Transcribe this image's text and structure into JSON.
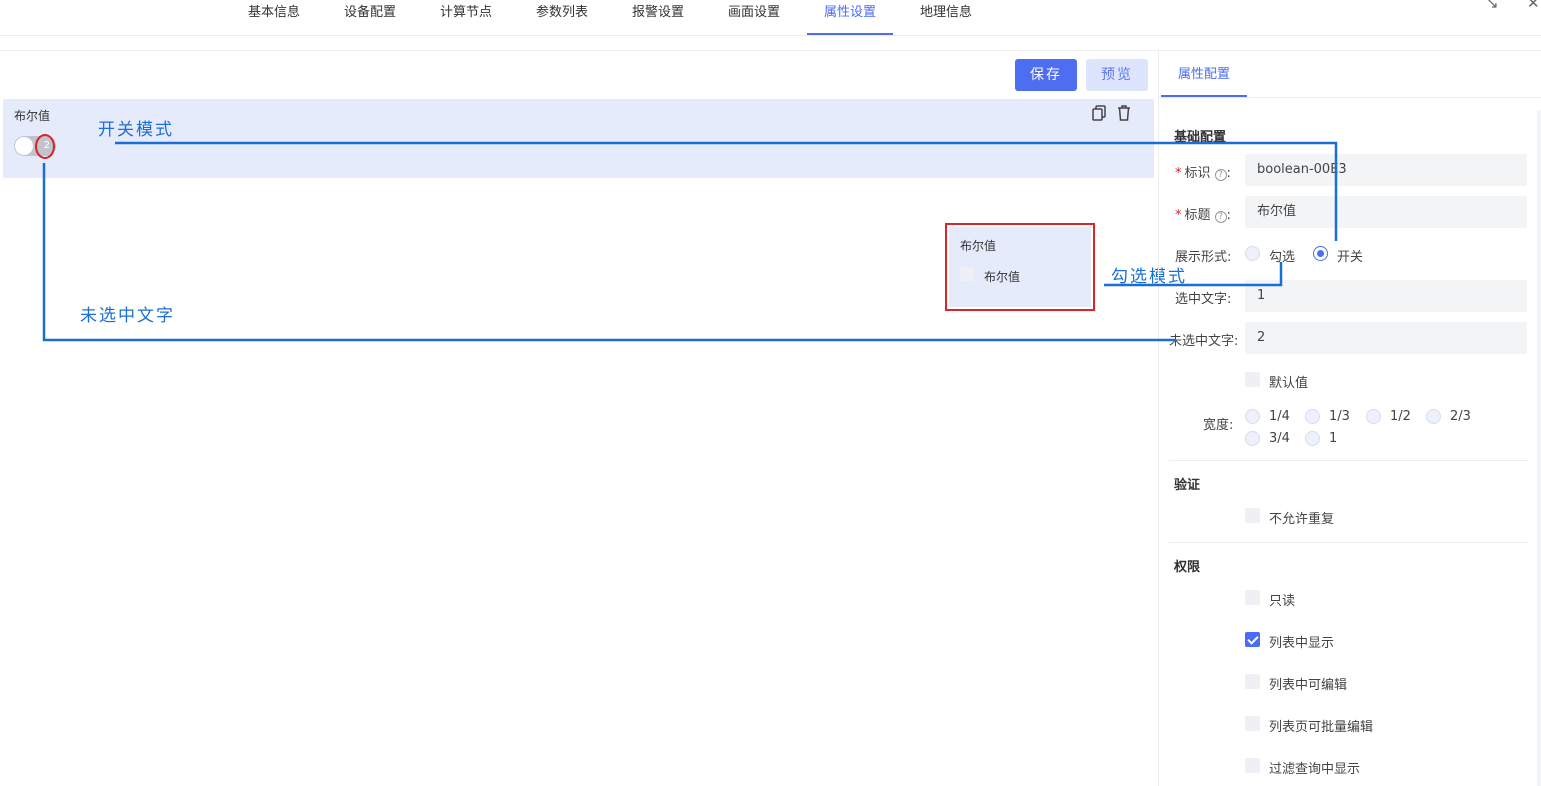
{
  "top_tabs": [
    "基本信息",
    "设备配置",
    "计算节点",
    "参数列表",
    "报警设置",
    "画面设置",
    "属性设置",
    "地理信息"
  ],
  "active_tab": "属性设置",
  "toolbar": {
    "save_label": "保存",
    "preview_label": "预览"
  },
  "canvas": {
    "field_label": "布尔值",
    "switch_text": "2",
    "checkbox_field_label": "布尔值",
    "checkbox_text": "布尔值"
  },
  "annotations": {
    "switch_mode": "开关模式",
    "checkbox_mode": "勾选模式",
    "unchecked_text": "未选中文字"
  },
  "panel": {
    "tab_label": "属性配置",
    "basic_title": "基础配置",
    "id_label": "标识",
    "id_value": "boolean-00E3",
    "title_label": "标题",
    "title_value": "布尔值",
    "display_label": "展示形式:",
    "display_options": [
      "勾选",
      "开关"
    ],
    "display_selected": "开关",
    "checked_text_label": "选中文字:",
    "checked_text_value": "1",
    "unchecked_text_label": "未选中文字:",
    "unchecked_text_value": "2",
    "default_label": "默认值",
    "width_label": "宽度:",
    "width_options": [
      "1/4",
      "1/3",
      "1/2",
      "2/3",
      "3/4",
      "1"
    ],
    "validate_title": "验证",
    "no_repeat_label": "不允许重复",
    "permission_title": "权限",
    "permissions": [
      {
        "label": "只读",
        "checked": false
      },
      {
        "label": "列表中显示",
        "checked": true
      },
      {
        "label": "列表中可编辑",
        "checked": false
      },
      {
        "label": "列表页可批量编辑",
        "checked": false
      },
      {
        "label": "过滤查询中显示",
        "checked": false
      }
    ]
  },
  "colors": {
    "accent": "#4a6cf7",
    "annotation": "#1a6fd6",
    "highlight": "#d9262b",
    "card_bg": "#e6ebfb"
  }
}
